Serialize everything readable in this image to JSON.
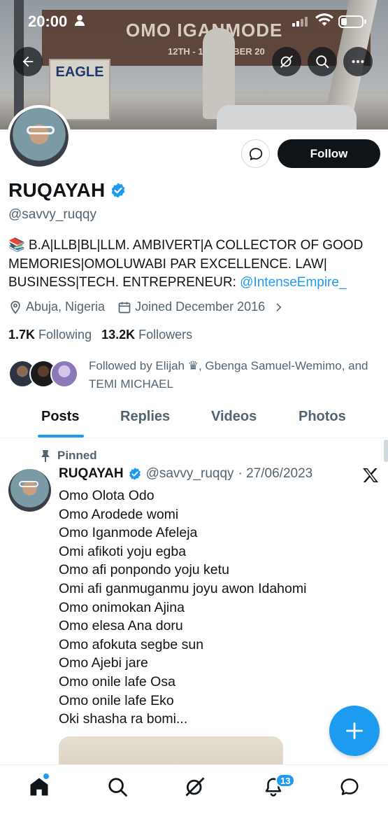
{
  "status_bar": {
    "time": "20:00"
  },
  "banner": {
    "arch_text": "OMO IGANMODE",
    "arch_date": "12TH - 17TH ... BER 20",
    "billboard_text": "EAGLE"
  },
  "profile": {
    "name": "RUQAYAH",
    "handle": "@savvy_ruqqy",
    "bio_text": "📚 B.A|LLB|BL|LLM. AMBIVERT|A COLLECTOR OF GOOD MEMORIES|OMOLUWABI PAR EXCELLENCE. LAW| BUSINESS|TECH. ENTREPRENEUR: ",
    "bio_link": "@IntenseEmpire_",
    "location": "Abuja, Nigeria",
    "joined": "Joined December 2016",
    "following_count": "1.7K",
    "following_label": "Following",
    "followers_count": "13.2K",
    "followers_label": "Followers",
    "followed_by": "Followed by Elijah ♛, Gbenga Samuel-Wemimo, and TEMI MICHAEL",
    "follow_label": "Follow"
  },
  "tabs": [
    {
      "label": "Posts",
      "active": true
    },
    {
      "label": "Replies",
      "active": false
    },
    {
      "label": "Videos",
      "active": false
    },
    {
      "label": "Photos",
      "active": false
    }
  ],
  "post": {
    "pinned_label": "Pinned",
    "author": "RUQAYAH",
    "handle": "@savvy_ruqqy",
    "date": "· 27/06/2023",
    "lines": [
      "Omo Olota Odo",
      "Omo Arodede womi",
      "Omo Iganmode Afeleja",
      "Omi afikoti yoju egba",
      "Omo afi ponpondo yoju ketu",
      "Omi afi ganmuganmu joyu awon Idahomi",
      "Omo onimokan Ajina",
      "Omo elesa Ana doru",
      "Omo afokuta segbe sun",
      "Omo Ajebi jare",
      "Omo onile lafe Osa",
      "Omo onile lafe Eko",
      "Oki shasha ra bomi..."
    ]
  },
  "bottom_nav": {
    "notifications_badge": "13"
  },
  "colors": {
    "accent": "#1d9bf0",
    "text": "#0f1419",
    "secondary": "#536471"
  }
}
